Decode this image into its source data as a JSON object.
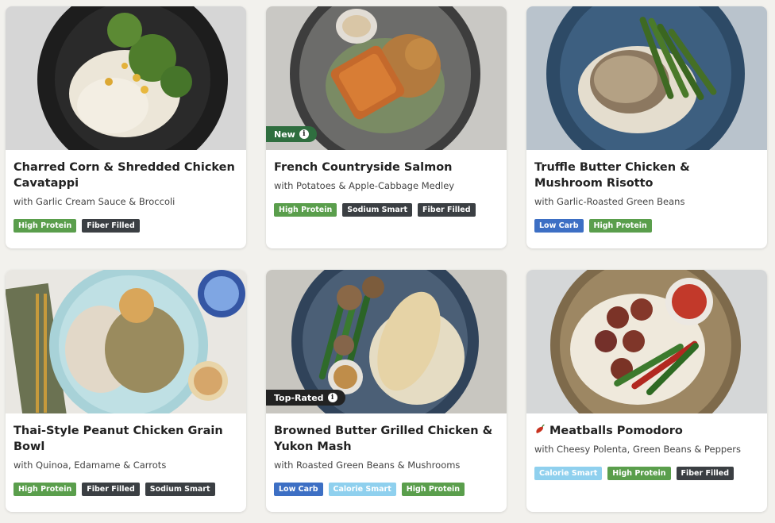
{
  "colors": {
    "tag_green": "#5a9e4c",
    "tag_dark": "#3b3f43",
    "tag_blue": "#3d6fc4",
    "tag_lightblue": "#8fd0ee",
    "badge_new": "#2f6e3f",
    "badge_top": "#222222"
  },
  "cards": [
    {
      "title": "Charred Corn & Shredded Chicken Cavatappi",
      "subtitle": "with Garlic Cream Sauce & Broccoli",
      "tags": [
        "High Protein",
        "Fiber Filled"
      ]
    },
    {
      "title": "French Countryside Salmon",
      "subtitle": "with Potatoes & Apple-Cabbage Medley",
      "badge": "New",
      "tags": [
        "High Protein",
        "Sodium Smart",
        "Fiber Filled"
      ]
    },
    {
      "title": "Truffle Butter Chicken & Mushroom Risotto",
      "subtitle": "with Garlic-Roasted Green Beans",
      "tags": [
        "Low Carb",
        "High Protein"
      ]
    },
    {
      "title": "Thai-Style Peanut Chicken Grain Bowl",
      "subtitle": "with Quinoa, Edamame & Carrots",
      "tags": [
        "High Protein",
        "Fiber Filled",
        "Sodium Smart"
      ]
    },
    {
      "title": "Browned Butter Grilled Chicken & Yukon Mash",
      "subtitle": "with Roasted Green Beans & Mushrooms",
      "badge": "Top-Rated",
      "tags": [
        "Low Carb",
        "Calorie Smart",
        "High Protein"
      ]
    },
    {
      "title": "Meatballs Pomodoro",
      "subtitle": "with Cheesy Polenta, Green Beans & Peppers",
      "spicy_icon": "chili-pepper-icon",
      "tags": [
        "Calorie Smart",
        "High Protein",
        "Fiber Filled"
      ]
    }
  ]
}
